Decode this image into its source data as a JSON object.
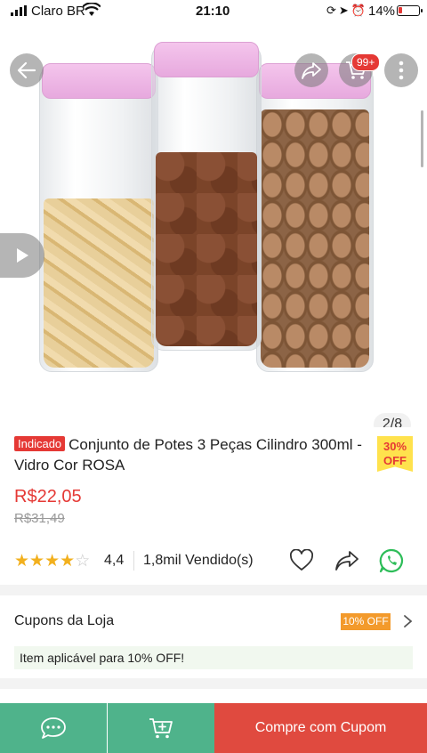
{
  "status_bar": {
    "carrier": "Claro BR",
    "time": "21:10",
    "battery": "14%",
    "icons": [
      "signal-icon",
      "wifi-icon",
      "lock-rotation-icon",
      "location-icon",
      "alarm-icon",
      "battery-icon"
    ]
  },
  "header": {
    "cart_badge": "99+",
    "icons": [
      "back-arrow-icon",
      "share-icon",
      "cart-icon",
      "more-vertical-icon"
    ]
  },
  "gallery": {
    "counter": "2/8",
    "icons": [
      "play-icon"
    ]
  },
  "product": {
    "tag": "Indicado",
    "title": "Conjunto de Potes 3 Peças Cilindro 300ml - Vidro Cor ROSA",
    "discount_percent": "30%",
    "discount_label": "OFF",
    "price": "R$22,05",
    "old_price": "R$31,49",
    "rating_value": "4,4",
    "rating_stars": 4.4,
    "sold": "1,8mil Vendido(s)",
    "icons": [
      "star-icon",
      "heart-icon",
      "share-icon",
      "whatsapp-icon"
    ]
  },
  "coupons": {
    "title": "Cupons da Loja",
    "tag": "10% OFF",
    "applicable": "Item aplicável para 10% OFF!",
    "icons": [
      "chevron-right-icon"
    ]
  },
  "bottom_bar": {
    "buy_label": "Compre com Cupom",
    "icons": [
      "chat-icon",
      "add-to-cart-icon"
    ]
  },
  "colors": {
    "accent_red": "#e53935",
    "green": "#4fb38b",
    "buy_red": "#e04a3f",
    "coupon_orange": "#f39a2b",
    "discount_yellow": "#ffe24d"
  }
}
